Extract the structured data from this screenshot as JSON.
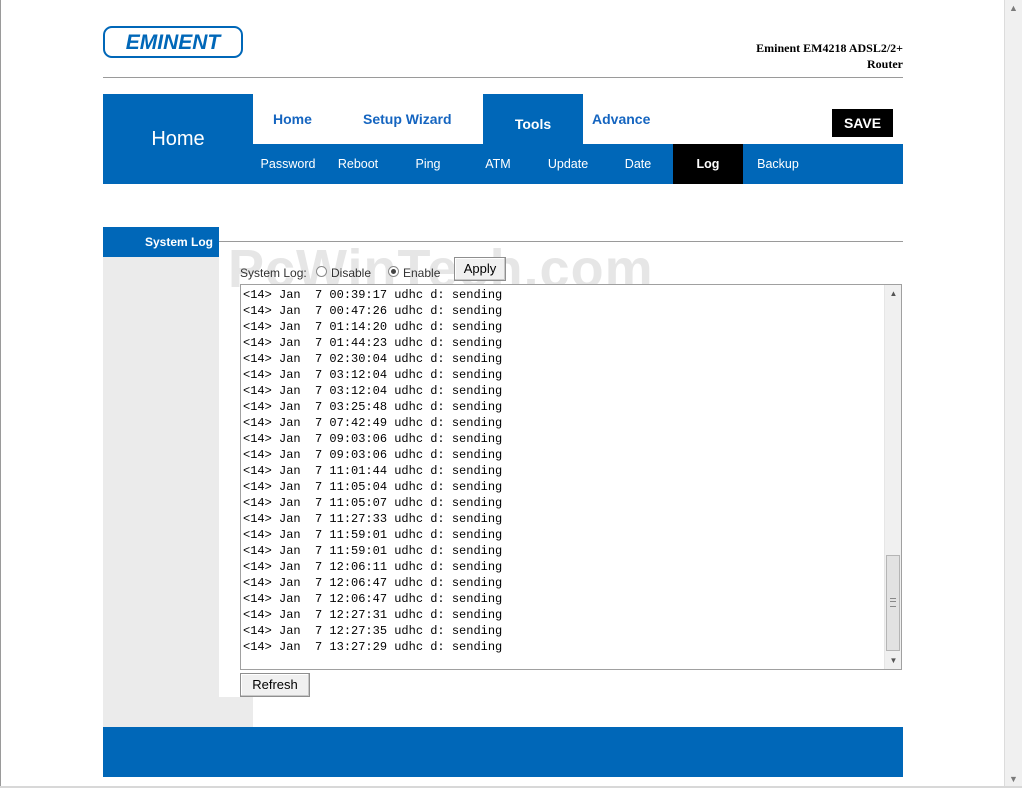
{
  "header": {
    "logo_text": "EMINENT",
    "model_line1": "Eminent EM4218 ADSL2/2+",
    "model_line2": "Router"
  },
  "nav": {
    "section_title": "Home",
    "main_tabs": [
      {
        "label": "Home"
      },
      {
        "label": "Setup Wizard"
      },
      {
        "label": "Tools"
      },
      {
        "label": "Advance"
      }
    ],
    "save_label": "SAVE",
    "sub_tabs": [
      {
        "label": "Password"
      },
      {
        "label": "Reboot"
      },
      {
        "label": "Ping"
      },
      {
        "label": "ATM"
      },
      {
        "label": "Update"
      },
      {
        "label": "Date"
      },
      {
        "label": "Log"
      },
      {
        "label": "Backup"
      }
    ]
  },
  "sidebar": {
    "title": "System Log"
  },
  "watermark": "PcWinTech.com",
  "syslog": {
    "label": "System Log:",
    "disable_label": "Disable",
    "enable_label": "Enable",
    "selected": "Enable",
    "apply_label": "Apply",
    "refresh_label": "Refresh"
  },
  "log": {
    "lines": [
      "<14> Jan  7 00:39:17 udhc d: sending",
      "<14> Jan  7 00:47:26 udhc d: sending",
      "<14> Jan  7 01:14:20 udhc d: sending",
      "<14> Jan  7 01:44:23 udhc d: sending",
      "<14> Jan  7 02:30:04 udhc d: sending",
      "<14> Jan  7 03:12:04 udhc d: sending",
      "<14> Jan  7 03:12:04 udhc d: sending",
      "<14> Jan  7 03:25:48 udhc d: sending",
      "<14> Jan  7 07:42:49 udhc d: sending",
      "<14> Jan  7 09:03:06 udhc d: sending",
      "<14> Jan  7 09:03:06 udhc d: sending",
      "<14> Jan  7 11:01:44 udhc d: sending",
      "<14> Jan  7 11:05:04 udhc d: sending",
      "<14> Jan  7 11:05:07 udhc d: sending",
      "<14> Jan  7 11:27:33 udhc d: sending",
      "<14> Jan  7 11:59:01 udhc d: sending",
      "<14> Jan  7 11:59:01 udhc d: sending",
      "<14> Jan  7 12:06:11 udhc d: sending",
      "<14> Jan  7 12:06:47 udhc d: sending",
      "<14> Jan  7 12:06:47 udhc d: sending",
      "<14> Jan  7 12:27:31 udhc d: sending",
      "<14> Jan  7 12:27:35 udhc d: sending",
      "<14> Jan  7 13:27:29 udhc d: sending"
    ]
  },
  "colors": {
    "brand_blue": "#0067b8",
    "link_blue": "#1565c0",
    "active_sub_tab": "#000000"
  },
  "icons": {
    "scroll_up": "scroll-up-arrow-icon",
    "scroll_down": "scroll-down-arrow-icon"
  }
}
